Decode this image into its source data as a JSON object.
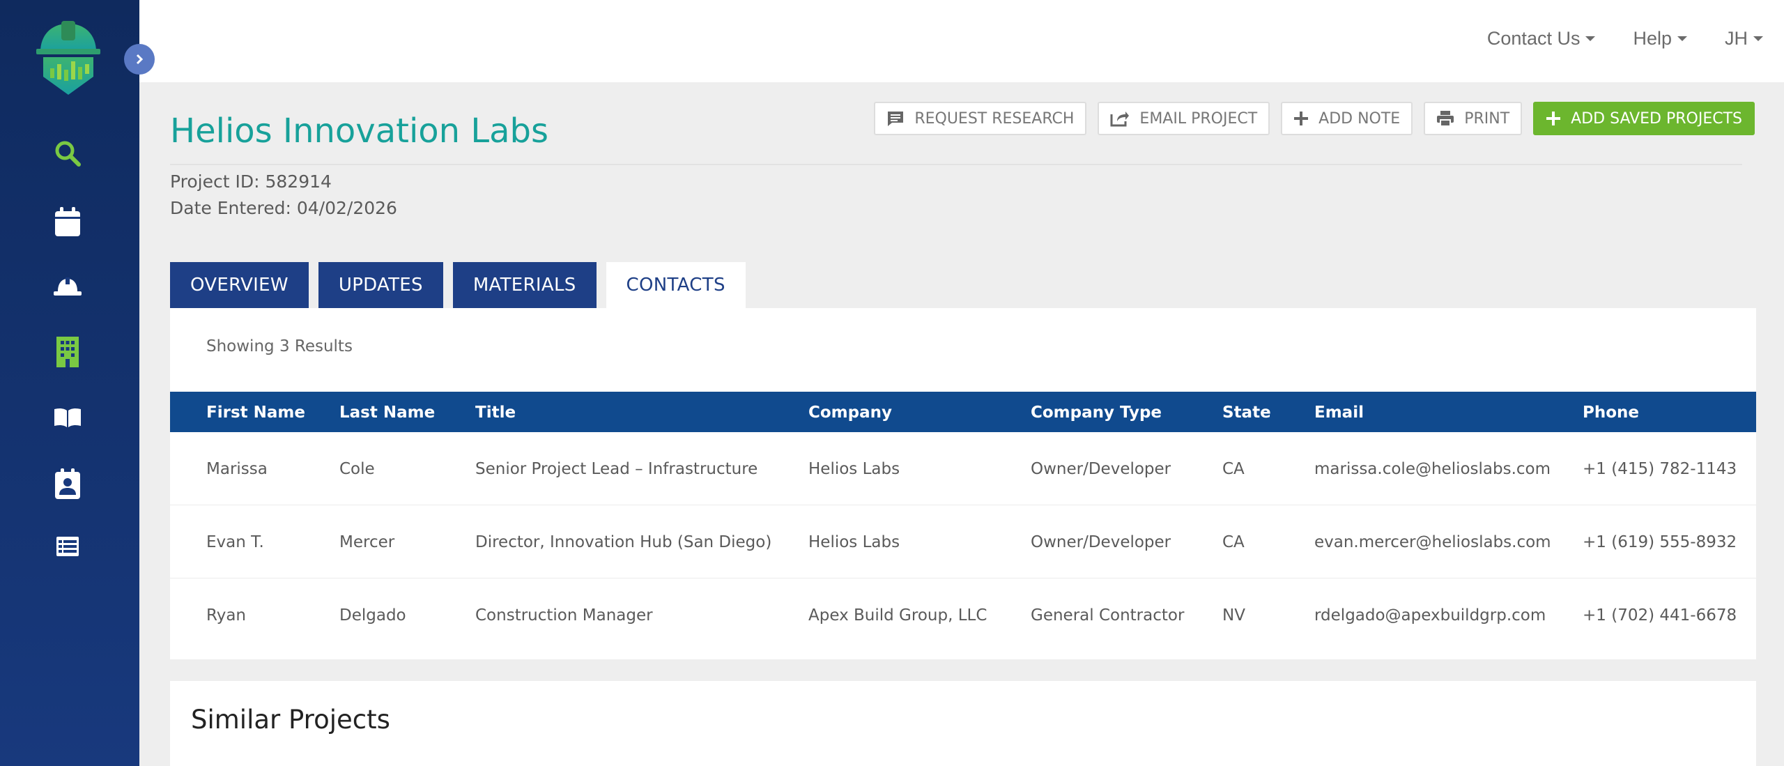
{
  "topnav": {
    "contact": "Contact Us",
    "help": "Help",
    "user": "JH"
  },
  "sidebar": {
    "items": [
      {
        "icon": "search-icon"
      },
      {
        "icon": "calendar-icon"
      },
      {
        "icon": "hard-hat-icon"
      },
      {
        "icon": "building-icon"
      },
      {
        "icon": "book-icon"
      },
      {
        "icon": "contact-card-icon"
      },
      {
        "icon": "list-icon"
      }
    ]
  },
  "project": {
    "title": "Helios Innovation Labs",
    "id_line": "Project ID: 582914",
    "date_line": "Date Entered: 04/02/2026"
  },
  "actions": {
    "request": "REQUEST RESEARCH",
    "email": "EMAIL PROJECT",
    "note": "ADD NOTE",
    "print": "PRINT",
    "save": "ADD SAVED PROJECTS"
  },
  "tabs": [
    "OVERVIEW",
    "UPDATES",
    "MATERIALS",
    "CONTACTS"
  ],
  "contacts": {
    "results_text": "Showing 3 Results",
    "headers": [
      "First Name",
      "Last Name",
      "Title",
      "Company",
      "Company Type",
      "State",
      "Email",
      "Phone"
    ],
    "rows": [
      [
        "Marissa",
        "Cole",
        "Senior Project Lead – Infrastructure",
        "Helios Labs",
        "Owner/Developer",
        "CA",
        "marissa.cole@helioslabs.com",
        "+1 (415) 782-1143"
      ],
      [
        "Evan T.",
        "Mercer",
        "Director, Innovation Hub (San Diego)",
        "Helios Labs",
        "Owner/Developer",
        "CA",
        "evan.mercer@helioslabs.com",
        "+1 (619) 555-8932"
      ],
      [
        "Ryan",
        "Delgado",
        "Construction Manager",
        "Apex Build Group, LLC",
        "General Contractor",
        "NV",
        "rdelgado@apexbuildgrp.com",
        "+1 (702) 441-6678"
      ]
    ]
  },
  "similar": {
    "title": "Similar Projects"
  },
  "colors": {
    "sidebar": "#0f2a5e",
    "accent_green": "#6cb62e",
    "title_teal": "#17a19a",
    "table_header": "#104a8e",
    "tab_blue": "#1e3f86"
  }
}
